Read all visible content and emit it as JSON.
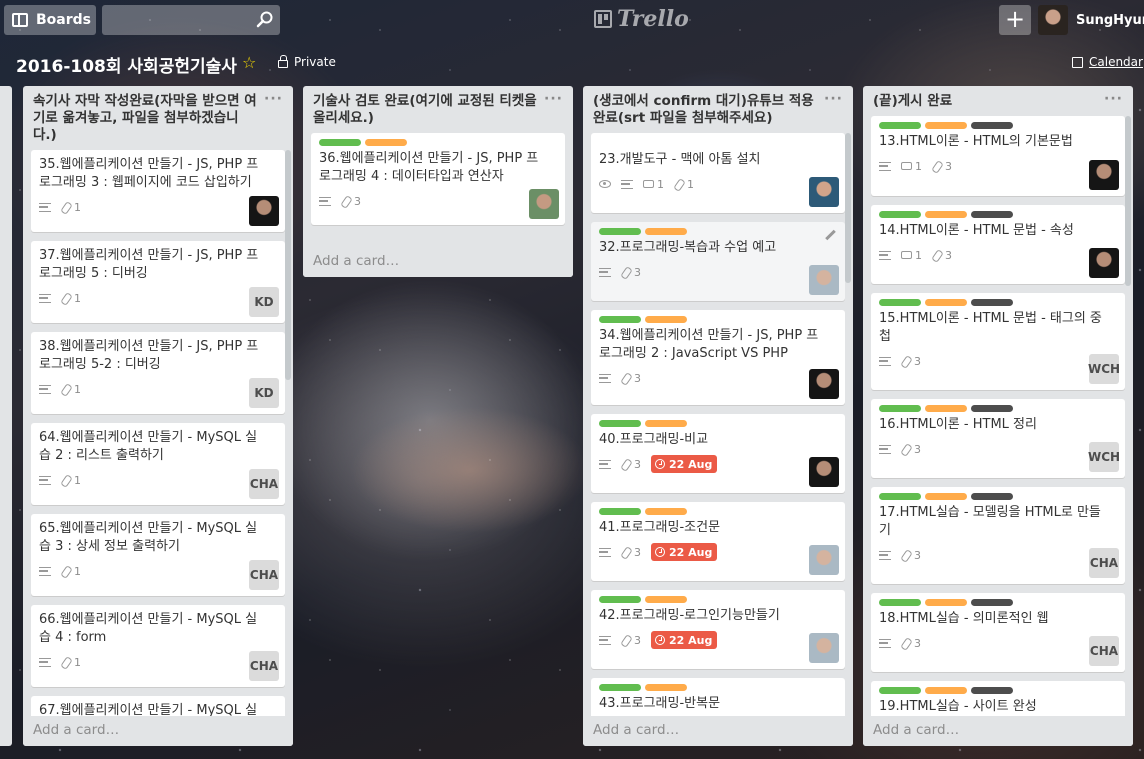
{
  "header": {
    "boards_label": "Boards",
    "search_value": "",
    "logo_text": "Trello",
    "plus_label": "+",
    "user_name": "SungHyun"
  },
  "board": {
    "title": "2016-108회 사회공헌기술사",
    "visibility": "Private",
    "calendar_label": "Calendar",
    "star_icon": "star-icon"
  },
  "colors": {
    "label_green": "#61bd4f",
    "label_orange": "#ffab4a",
    "label_black": "#4d4d4d",
    "due_red": "#eb5a46",
    "list_bg": "#e2e4e6"
  },
  "lists": [
    {
      "title": "속기사 자막 작성완료(자막을 받으면 여기로 옮겨놓고, 파일을 첨부하겠습니다.)",
      "menu": "···",
      "add_card": "Add a card…",
      "cards": [
        {
          "title": "35.웹에플리케이션 만들기 - JS, PHP 프로그래밍 3 : 웹페이지에 코드 삽입하기",
          "attachments": "1",
          "member": ""
        },
        {
          "title": "37.웹에플리케이션 만들기 - JS, PHP 프로그래밍 5 : 디버깅",
          "attachments": "1",
          "member": "KD"
        },
        {
          "title": "38.웹에플리케이션 만들기 - JS, PHP 프로그래밍 5-2 : 디버깅",
          "attachments": "1",
          "member": "KD"
        },
        {
          "title": "64.웹에플리케이션 만들기 - MySQL 실습 2 : 리스트 출력하기",
          "attachments": "1",
          "member": "CHA"
        },
        {
          "title": "65.웹에플리케이션 만들기 - MySQL 실습 3 : 상세 정보 출력하기",
          "attachments": "1",
          "member": "CHA"
        },
        {
          "title": "66.웹에플리케이션 만들기 - MySQL 실습 4 : form",
          "attachments": "1",
          "member": "CHA"
        },
        {
          "title": "67.웹에플리케이션 만들기 - MySQL 실",
          "attachments": "",
          "member": ""
        }
      ]
    },
    {
      "title": "기술사 검토 완료(여기에 교정된 티켓을 올리세요.)",
      "menu": "···",
      "add_card": "Add a card…",
      "cards": [
        {
          "title": "36.웹에플리케이션 만들기 - JS, PHP 프로그래밍 4 : 데이터타입과 연산자",
          "attachments": "3",
          "member": ""
        }
      ]
    },
    {
      "title": "(생코에서 confirm 대기)유튜브 적용 완료(srt 파일을 첨부해주세요)",
      "menu": "···",
      "add_card": "Add a card…",
      "cards": [
        {
          "title": "23.개발도구 - 맥에 아톰 설치",
          "comments": "1",
          "attachments": "1",
          "due": ""
        },
        {
          "title": "32.프로그래밍-복습과 수업 예고",
          "attachments": "3",
          "due": ""
        },
        {
          "title": "34.웹에플리케이션 만들기 - JS, PHP 프로그래밍 2 : JavaScript VS PHP",
          "attachments": "3",
          "due": ""
        },
        {
          "title": "40.프로그래밍-비교",
          "attachments": "3",
          "due": "22 Aug"
        },
        {
          "title": "41.프로그래밍-조건문",
          "attachments": "3",
          "due": "22 Aug"
        },
        {
          "title": "42.프로그래밍-로그인기능만들기",
          "attachments": "3",
          "due": "22 Aug"
        },
        {
          "title": "43.프로그래밍-반복문",
          "attachments": "",
          "due": ""
        }
      ]
    },
    {
      "title": "(끝)게시 완료",
      "menu": "···",
      "add_card": "Add a card…",
      "cards": [
        {
          "title": "13.HTML이론 - HTML의 기본문법",
          "comments": "1",
          "attachments": "3",
          "member": ""
        },
        {
          "title": "14.HTML이론 - HTML 문법 - 속성",
          "comments": "1",
          "attachments": "3",
          "member": ""
        },
        {
          "title": "15.HTML이론 - HTML 문법 - 태그의 중첩",
          "attachments": "3",
          "member": "WCH"
        },
        {
          "title": "16.HTML이론 - HTML 정리",
          "attachments": "3",
          "member": "WCH"
        },
        {
          "title": "17.HTML실습 - 모델링을 HTML로 만들기",
          "attachments": "3",
          "member": "CHA"
        },
        {
          "title": "18.HTML실습 - 의미론적인 웹",
          "attachments": "3",
          "member": "CHA"
        },
        {
          "title": "19.HTML실습 - 사이트 완성",
          "attachments": "",
          "member": ""
        }
      ]
    }
  ]
}
